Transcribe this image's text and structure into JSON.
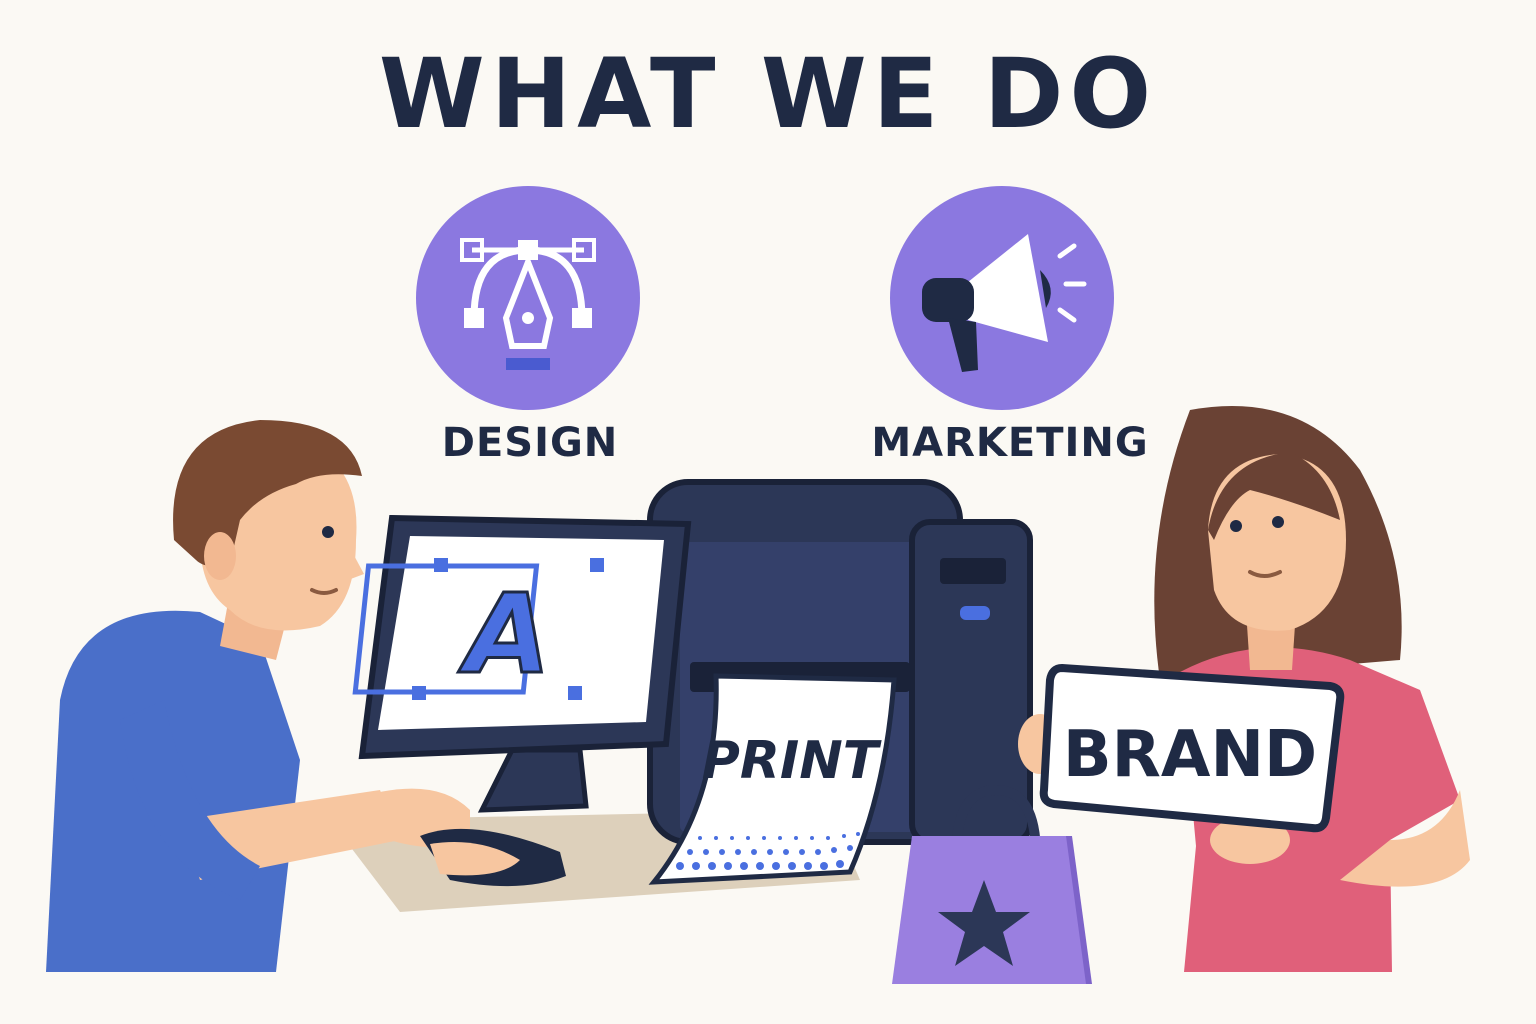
{
  "heading": "WHAT WE DO",
  "services": [
    {
      "label": "DESIGN",
      "icon": "pen-tool-icon"
    },
    {
      "label": "MARKETING",
      "icon": "megaphone-icon"
    }
  ],
  "monitor_letter": "A",
  "print_text": "PRINT",
  "sign_text": "BRAND",
  "colors": {
    "navy": "#1f2a44",
    "purple": "#8b78e0",
    "blue_shirt": "#4a6fc9",
    "pink_shirt": "#e0607a",
    "background": "#fbf9f4"
  }
}
